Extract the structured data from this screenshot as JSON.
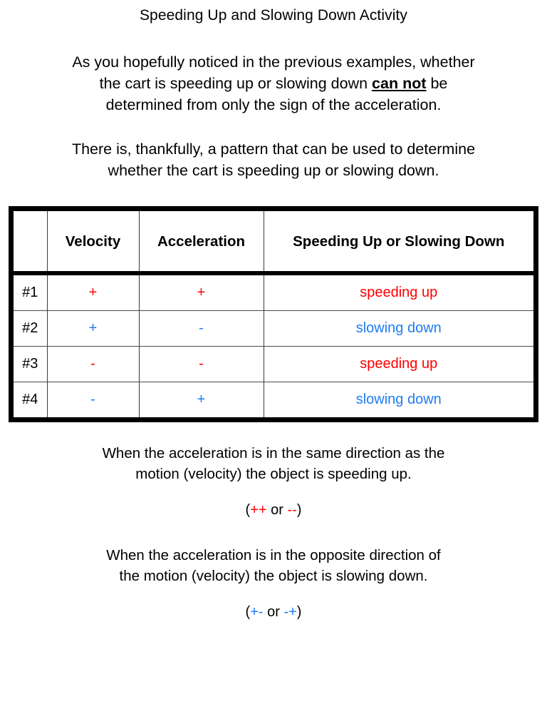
{
  "title": "Speeding Up and Slowing Down Activity",
  "intro": {
    "line1_a": "As you hopefully noticed in the previous examples, whether",
    "line2_a": "the cart is speeding up or slowing down ",
    "line2_emphasis": "can not",
    "line2_b": " be",
    "line3": "determined from only the sign of the acceleration."
  },
  "pattern": {
    "line1": "There is, thankfully, a pattern that can be used to determine",
    "line2": "whether the cart is speeding up or slowing down."
  },
  "table": {
    "headers": {
      "num": "",
      "velocity": "Velocity",
      "acceleration": "Acceleration",
      "result": "Speeding Up or Slowing Down"
    },
    "rows": [
      {
        "num": "#1",
        "velocity": "+",
        "acceleration": "+",
        "result": "speeding up",
        "color": "#ff0000"
      },
      {
        "num": "#2",
        "velocity": "+",
        "acceleration": "-",
        "result": "slowing down",
        "color": "#1f7cf2"
      },
      {
        "num": "#3",
        "velocity": "-",
        "acceleration": "-",
        "result": "speeding up",
        "color": "#ff0000"
      },
      {
        "num": "#4",
        "velocity": "-",
        "acceleration": "+",
        "result": "slowing down",
        "color": "#1f7cf2"
      }
    ]
  },
  "rule_same": {
    "line1": "When the acceleration is in the same direction as the",
    "line2": "motion (velocity) the object is speeding up.",
    "signs_open": "(",
    "signs_first": "++",
    "signs_or": " or ",
    "signs_second": "--",
    "signs_close": ")"
  },
  "rule_opposite": {
    "line1": "When the acceleration is in the opposite direction of",
    "line2": "the motion (velocity) the object is slowing down.",
    "signs_open": "(",
    "signs_first": "+-",
    "signs_or": " or ",
    "signs_second": "-+",
    "signs_close": ")"
  },
  "colors": {
    "speeding_up": "#ff0000",
    "slowing_down": "#1f7cf2",
    "text": "#000000",
    "table_border": "#000000",
    "row_divider": "#4a4a4a"
  }
}
